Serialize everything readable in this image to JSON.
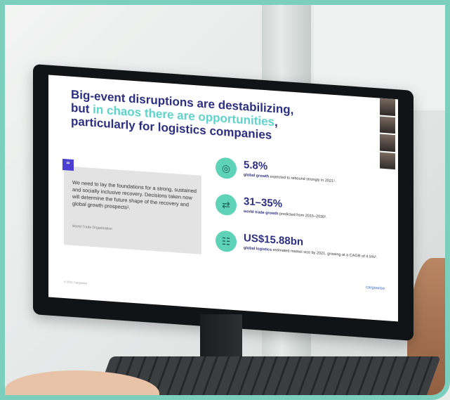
{
  "slide": {
    "title_part1": "Big-event disruptions are destabilizing,",
    "title_part2": "but ",
    "title_accent": "in chaos there are opportunities",
    "title_part3": ",",
    "title_part4": "particularly for logistics companies",
    "quote_mark": "“",
    "quote": "We need to lay the foundations for a strong, sustained and socially inclusive recovery. Decisions taken now will determine the future shape of the recovery and global growth prospects¹.",
    "quote_source": "World Trade Organization",
    "stats": [
      {
        "icon": "globe-icon",
        "glyph": "◎",
        "value": "5.8%",
        "label_bold": "global growth",
        "label_rest": " expected to rebound strongly in 2021¹."
      },
      {
        "icon": "trade-arrows-icon",
        "glyph": "⇄",
        "value": "31–35%",
        "label_bold": "world trade growth",
        "label_rest": " predicted from 2015–2030²."
      },
      {
        "icon": "truck-icon",
        "glyph": "☷",
        "value": "US$15.88bn",
        "label_bold": "global logistics",
        "label_rest": " estimated market size by 2021, growing at a CAGR of 4.5%³."
      }
    ],
    "logo": "cargowise",
    "copyright": "© 2021 Cargowise"
  },
  "colors": {
    "frame": "#7ccfbd",
    "title": "#2c2f80",
    "accent": "#5fd3c9",
    "icon_bg": "#5fd3b8",
    "quote_mark_bg": "#4b3fd1"
  }
}
